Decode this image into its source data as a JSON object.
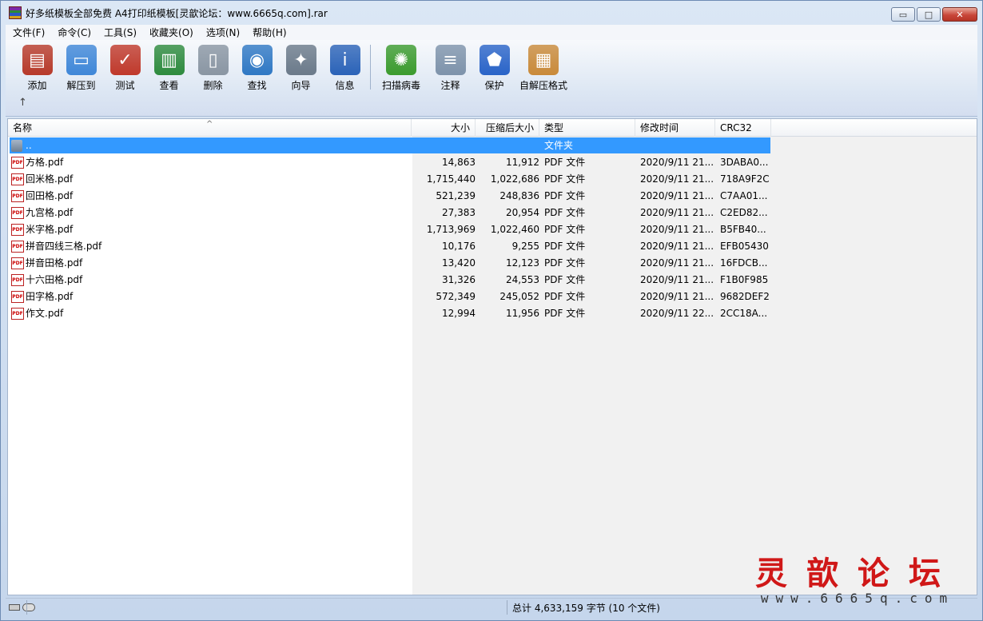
{
  "window": {
    "title": "好多纸模板全部免费 A4打印纸模板[灵歆论坛：www.6665q.com].rar",
    "controls": {
      "minimize": "▭",
      "maximize": "□",
      "close": "✕"
    }
  },
  "menu": [
    "文件(F)",
    "命令(C)",
    "工具(S)",
    "收藏夹(O)",
    "选项(N)",
    "帮助(H)"
  ],
  "toolbar": {
    "tools": [
      {
        "label": "添加",
        "icon": "rar-books-icon",
        "color": "#b73a2a",
        "glyph": "▤"
      },
      {
        "label": "解压到",
        "icon": "folder-extract-icon",
        "color": "#3f87d8",
        "glyph": "▭"
      },
      {
        "label": "测试",
        "icon": "clipboard-check-icon",
        "color": "#c0392b",
        "glyph": "✓"
      },
      {
        "label": "查看",
        "icon": "open-book-icon",
        "color": "#2e8b3e",
        "glyph": "▥"
      },
      {
        "label": "删除",
        "icon": "trash-can-icon",
        "color": "#8a96a3",
        "glyph": "▯"
      },
      {
        "label": "查找",
        "icon": "magnifier-icon",
        "color": "#2f78c4",
        "glyph": "◉"
      },
      {
        "label": "向导",
        "icon": "magic-wand-icon",
        "color": "#6b7a8a",
        "glyph": "✦"
      },
      {
        "label": "信息",
        "icon": "info-icon",
        "color": "#2b63b8",
        "glyph": "i"
      },
      {
        "label": "扫描病毒",
        "icon": "virus-scan-icon",
        "color": "#3b9b2e",
        "glyph": "✺"
      },
      {
        "label": "注释",
        "icon": "comment-icon",
        "color": "#7e93ab",
        "glyph": "≡"
      },
      {
        "label": "保护",
        "icon": "shield-icon",
        "color": "#2a64c8",
        "glyph": "⬟"
      },
      {
        "label": "自解压格式",
        "icon": "sfx-box-icon",
        "color": "#c98a3a",
        "glyph": "▦"
      }
    ],
    "up_label": "↑"
  },
  "columns": {
    "name": "名称",
    "size": "大小",
    "packed": "压缩后大小",
    "type": "类型",
    "modified": "修改时间",
    "crc": "CRC32"
  },
  "parent_row": {
    "name": "..",
    "type": "文件夹"
  },
  "files": [
    {
      "name": "方格.pdf",
      "size": "14,863",
      "packed": "11,912",
      "type": "PDF 文件",
      "modified": "2020/9/11 21...",
      "crc": "3DABA0..."
    },
    {
      "name": "回米格.pdf",
      "size": "1,715,440",
      "packed": "1,022,686",
      "type": "PDF 文件",
      "modified": "2020/9/11 21...",
      "crc": "718A9F2C"
    },
    {
      "name": "回田格.pdf",
      "size": "521,239",
      "packed": "248,836",
      "type": "PDF 文件",
      "modified": "2020/9/11 21...",
      "crc": "C7AA01..."
    },
    {
      "name": "九宫格.pdf",
      "size": "27,383",
      "packed": "20,954",
      "type": "PDF 文件",
      "modified": "2020/9/11 21...",
      "crc": "C2ED82..."
    },
    {
      "name": "米字格.pdf",
      "size": "1,713,969",
      "packed": "1,022,460",
      "type": "PDF 文件",
      "modified": "2020/9/11 21...",
      "crc": "B5FB40..."
    },
    {
      "name": "拼音四线三格.pdf",
      "size": "10,176",
      "packed": "9,255",
      "type": "PDF 文件",
      "modified": "2020/9/11 21...",
      "crc": "EFB05430"
    },
    {
      "name": "拼音田格.pdf",
      "size": "13,420",
      "packed": "12,123",
      "type": "PDF 文件",
      "modified": "2020/9/11 21...",
      "crc": "16FDCB..."
    },
    {
      "name": "十六田格.pdf",
      "size": "31,326",
      "packed": "24,553",
      "type": "PDF 文件",
      "modified": "2020/9/11 21...",
      "crc": "F1B0F985"
    },
    {
      "name": "田字格.pdf",
      "size": "572,349",
      "packed": "245,052",
      "type": "PDF 文件",
      "modified": "2020/9/11 21...",
      "crc": "9682DEF2"
    },
    {
      "name": "作文.pdf",
      "size": "12,994",
      "packed": "11,956",
      "type": "PDF 文件",
      "modified": "2020/9/11 22...",
      "crc": "2CC18A..."
    }
  ],
  "pdf_icon_text": "PDF",
  "status": {
    "summary": "总计 4,633,159 字节 (10 个文件)"
  },
  "watermark": {
    "main": "灵歆论坛",
    "url": "www.6665q.com"
  }
}
